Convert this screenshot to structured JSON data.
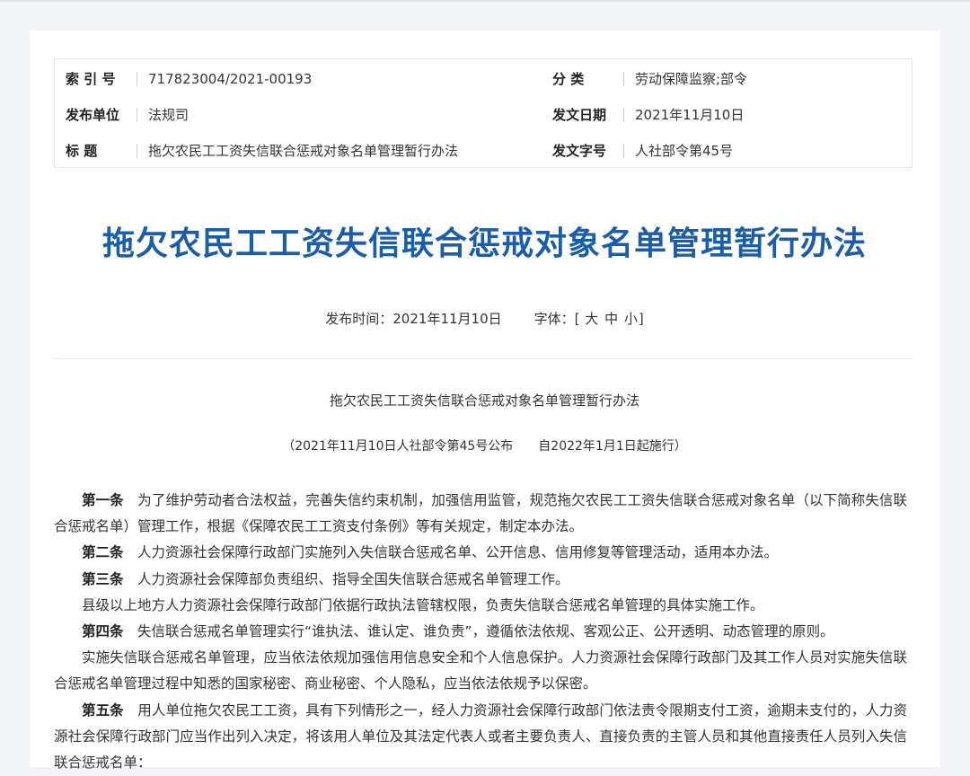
{
  "meta": {
    "rows": [
      {
        "left_key": "索 引 号",
        "left_val": "717823004/2021-00193",
        "right_key": "分    类",
        "right_val": "劳动保障监察;部令"
      },
      {
        "left_key": "发布单位",
        "left_val": "法规司",
        "right_key": "发文日期",
        "right_val": "2021年11月10日"
      },
      {
        "left_key": "标    题",
        "left_val": "拖欠农民工工资失信联合惩戒对象名单管理暂行办法",
        "right_key": "发文字号",
        "right_val": "人社部令第45号"
      }
    ]
  },
  "title": "拖欠农民工工资失信联合惩戒对象名单管理暂行办法",
  "pub": {
    "time_label": "发布时间：2021年11月10日",
    "font_label": "字体：[",
    "font_large": "大",
    "font_medium": "中",
    "font_small": "小",
    "font_close": "]"
  },
  "doc": {
    "subtitle": "拖欠农民工工资失信联合惩戒对象名单管理暂行办法",
    "note": "（2021年11月10日人社部令第45号公布　　自2022年1月1日起施行）",
    "paragraphs": [
      {
        "head": "第一条",
        "text": "　为了维护劳动者合法权益，完善失信约束机制，加强信用监管，规范拖欠农民工工资失信联合惩戒对象名单（以下简称失信联合惩戒名单）管理工作，根据《保障农民工工资支付条例》等有关规定，制定本办法。"
      },
      {
        "head": "第二条",
        "text": "　人力资源社会保障行政部门实施列入失信联合惩戒名单、公开信息、信用修复等管理活动，适用本办法。"
      },
      {
        "head": "第三条",
        "text": "　人力资源社会保障部负责组织、指导全国失信联合惩戒名单管理工作。"
      },
      {
        "head": "",
        "text": "县级以上地方人力资源社会保障行政部门依据行政执法管辖权限，负责失信联合惩戒名单管理的具体实施工作。"
      },
      {
        "head": "第四条",
        "text": "　失信联合惩戒名单管理实行“谁执法、谁认定、谁负责”，遵循依法依规、客观公正、公开透明、动态管理的原则。"
      },
      {
        "head": "",
        "text": "实施失信联合惩戒名单管理，应当依法依规加强信用信息安全和个人信息保护。人力资源社会保障行政部门及其工作人员对实施失信联合惩戒名单管理过程中知悉的国家秘密、商业秘密、个人隐私，应当依法依规予以保密。"
      },
      {
        "head": "第五条",
        "text": "　用人单位拖欠农民工工资，具有下列情形之一，经人力资源社会保障行政部门依法责令限期支付工资，逾期未支付的，人力资源社会保障行政部门应当作出列入决定，将该用人单位及其法定代表人或者主要负责人、直接负责的主管人员和其他直接责任人员列入失信联合惩戒名单："
      }
    ]
  }
}
